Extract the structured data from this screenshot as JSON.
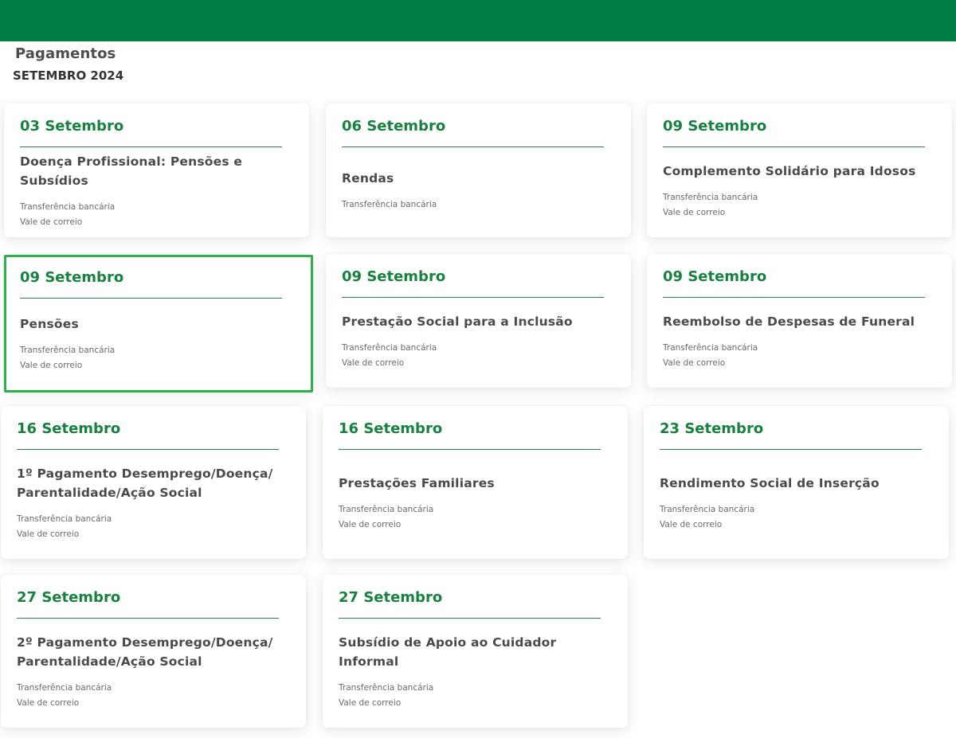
{
  "header": {
    "title": "Pagamentos",
    "subtitle": "SETEMBRO 2024",
    "brand_color": "#007d45"
  },
  "payments": [
    {
      "date": "03 Setembro",
      "title": "Doença Profissional: Pensões e Subsídios",
      "methods": [
        "Transferência bancária",
        "Vale de correio"
      ]
    },
    {
      "date": "06 Setembro",
      "title": "Rendas",
      "methods": [
        "Transferência bancária"
      ]
    },
    {
      "date": "09 Setembro",
      "title": "Complemento Solidário para Idosos",
      "methods": [
        "Transferência bancária",
        "Vale de correio"
      ]
    },
    {
      "date": "09 Setembro",
      "title": "Pensões",
      "methods": [
        "Transferência bancária",
        "Vale de correio"
      ],
      "selected": true
    },
    {
      "date": "09 Setembro",
      "title": "Prestação Social para a Inclusão",
      "methods": [
        "Transferência bancária",
        "Vale de correio"
      ]
    },
    {
      "date": "09 Setembro",
      "title": "Reembolso de Despesas de Funeral",
      "methods": [
        "Transferência bancária",
        "Vale de correio"
      ]
    },
    {
      "date": "16 Setembro",
      "title": "1º Pagamento Desemprego/Doença/ Parentalidade/Ação Social",
      "methods": [
        "Transferência bancária",
        "Vale de correio"
      ]
    },
    {
      "date": "16 Setembro",
      "title": "Prestações Familiares",
      "methods": [
        "Transferência bancária",
        "Vale de correio"
      ]
    },
    {
      "date": "23 Setembro",
      "title": "Rendimento Social de Inserção",
      "methods": [
        "Transferência bancária",
        "Vale de correio"
      ]
    },
    {
      "date": "27 Setembro",
      "title": "2º Pagamento Desemprego/Doença/ Parentalidade/Ação Social",
      "methods": [
        "Transferência bancária",
        "Vale de correio"
      ]
    },
    {
      "date": "27 Setembro",
      "title": "Subsídio de Apoio ao Cuidador Informal",
      "methods": [
        "Transferência bancária",
        "Vale de correio"
      ]
    }
  ]
}
